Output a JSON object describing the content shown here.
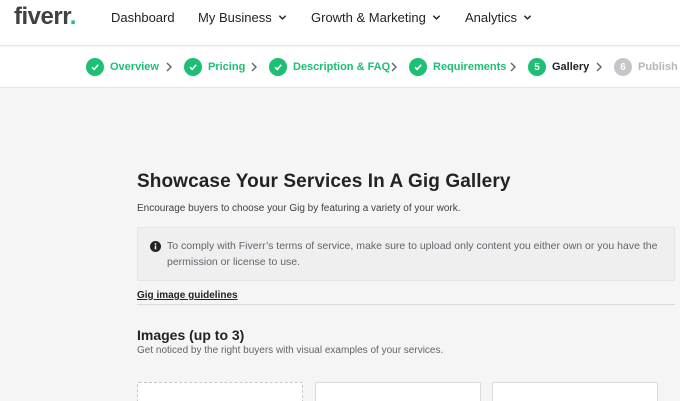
{
  "header": {
    "logo": "fiverr",
    "logo_dot": ".",
    "nav": [
      {
        "label": "Dashboard",
        "has_menu": false
      },
      {
        "label": "My Business",
        "has_menu": true
      },
      {
        "label": "Growth & Marketing",
        "has_menu": true
      },
      {
        "label": "Analytics",
        "has_menu": true
      }
    ]
  },
  "steps": [
    {
      "label": "Overview",
      "state": "done",
      "number": ""
    },
    {
      "label": "Pricing",
      "state": "done",
      "number": ""
    },
    {
      "label": "Description & FAQ",
      "state": "done",
      "number": ""
    },
    {
      "label": "Requirements",
      "state": "done",
      "number": ""
    },
    {
      "label": "Gallery",
      "state": "current",
      "number": "5"
    },
    {
      "label": "Publish",
      "state": "pending",
      "number": "6"
    }
  ],
  "main": {
    "title": "Showcase Your Services In A Gig Gallery",
    "subtitle": "Encourage buyers to choose your Gig by featuring a variety of your work.",
    "notice": "To comply with Fiverr’s terms of service, make sure to upload only content you either own or you have the permission or license to use.",
    "guidelines_link": "Gig image guidelines",
    "images_title": "Images (up to 3)",
    "images_subtitle": "Get noticed by the right buyers with visual examples of your services."
  },
  "colors": {
    "brand_green": "#1dbf73",
    "text_dark": "#222325",
    "pending_gray": "#c5c6c9"
  }
}
